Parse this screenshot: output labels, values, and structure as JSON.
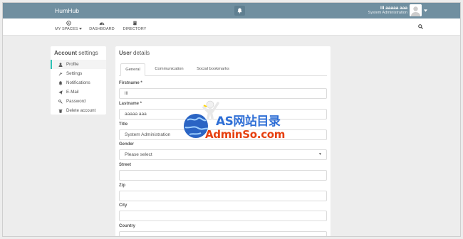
{
  "app": {
    "brand": "HumHub",
    "colors": {
      "topbar": "#708fa0",
      "accent": "#2ec2b6"
    }
  },
  "topbar": {
    "notification_icon": "bell-icon",
    "user_name": "lll aaaaa aaa",
    "user_role": "System Administration"
  },
  "nav": {
    "items": [
      {
        "label": "MY SPACES",
        "icon": "spaces-icon"
      },
      {
        "label": "DASHBOARD",
        "icon": "dashboard-icon"
      },
      {
        "label": "DIRECTORY",
        "icon": "book-icon"
      }
    ],
    "search_icon": "search-icon"
  },
  "account_menu": {
    "title_bold": "Account",
    "title_rest": "settings",
    "items": [
      {
        "label": "Profile",
        "icon": "user-icon",
        "active": true
      },
      {
        "label": "Settings",
        "icon": "wrench-icon"
      },
      {
        "label": "Notifications",
        "icon": "bell-icon"
      },
      {
        "label": "E-Mail",
        "icon": "paper-plane-icon"
      },
      {
        "label": "Password",
        "icon": "key-icon"
      },
      {
        "label": "Delete account",
        "icon": "trash-icon"
      }
    ]
  },
  "user_details": {
    "title_bold": "User",
    "title_rest": "details",
    "tabs": [
      {
        "label": "General",
        "active": true
      },
      {
        "label": "Communication"
      },
      {
        "label": "Social bookmarks"
      }
    ],
    "fields": [
      {
        "label": "Firstname *",
        "value": "lll"
      },
      {
        "label": "Lastname *",
        "value": "aaaaa aaa"
      },
      {
        "label": "Title",
        "value": "System Administration"
      },
      {
        "label": "Gender",
        "value": "Please select",
        "type": "select"
      },
      {
        "label": "Street",
        "value": ""
      },
      {
        "label": "Zip",
        "value": ""
      },
      {
        "label": "City",
        "value": ""
      },
      {
        "label": "Country",
        "value": ""
      }
    ]
  },
  "watermark": {
    "line1": "AS网站目录",
    "line2": "AdminSo.com"
  }
}
